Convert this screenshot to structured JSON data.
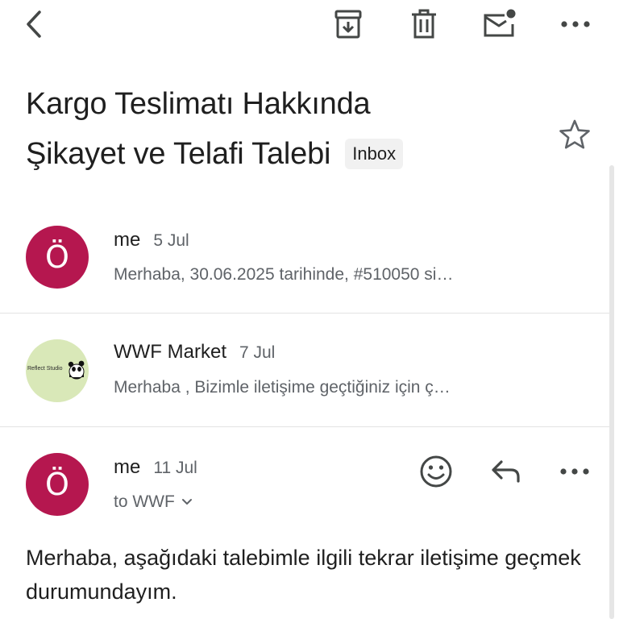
{
  "toolbar": {
    "back_icon": "arrow-back-icon",
    "archive_icon": "archive-icon",
    "delete_icon": "trash-icon",
    "unread_icon": "mark-unread-icon",
    "more_icon": "more-horizontal-icon"
  },
  "email": {
    "subject_line1": "Kargo Teslimatı Hakkında",
    "subject_line2": "Şikayet ve Telafi Talebi",
    "label": "Inbox",
    "star_icon": "star-outline-icon"
  },
  "thread": [
    {
      "avatar_letter": "Ö",
      "avatar_color": "#b5174f",
      "sender": "me",
      "date": "5 Jul",
      "snippet": "Merhaba, 30.06.2025 tarihinde, #510050 si…"
    },
    {
      "avatar_logo_text": "Reflect Studio",
      "avatar_color": "#d9e8b8",
      "sender": "WWF Market",
      "date": "7 Jul",
      "snippet": "Merhaba , Bizimle iletişime geçtiğiniz için ç…"
    }
  ],
  "open_message": {
    "avatar_letter": "Ö",
    "avatar_color": "#b5174f",
    "sender": "me",
    "date": "11 Jul",
    "to": "to WWF",
    "emoji_icon": "add-reaction-icon",
    "reply_icon": "reply-icon",
    "more_icon": "more-horizontal-icon",
    "body": "Merhaba, aşağıdaki talebimle ilgili tekrar iletişime geçmek durumundayım."
  }
}
